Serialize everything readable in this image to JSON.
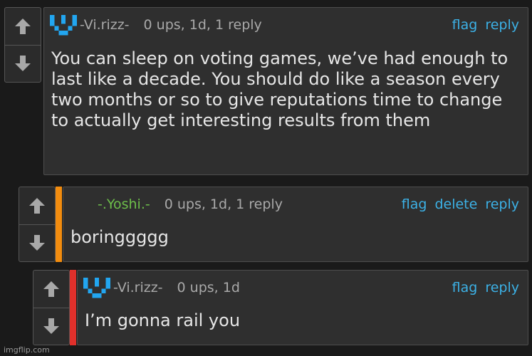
{
  "vote": {
    "up_icon": "arrow-up-icon",
    "down_icon": "arrow-down-icon"
  },
  "comments": [
    {
      "username": "-Vi.rizz-",
      "avatar_icon": "blue-pixel-v-avatar",
      "meta": "0 ups, 1d, 1 reply",
      "actions": {
        "flag": "flag",
        "reply": "reply"
      },
      "text": "You can sleep on voting games, we’ve had enough to last like a decade. You should do like a season every two months or so to give reputations time to change to actually get interesting results from them"
    },
    {
      "username": "-.Yoshi.-",
      "username_color": "#6dbf4a",
      "bar_color": "#f28c0f",
      "meta": "0 ups, 1d, 1 reply",
      "actions": {
        "flag": "flag",
        "delete": "delete",
        "reply": "reply"
      },
      "text": "boringgggg"
    },
    {
      "username": "-Vi.rizz-",
      "avatar_icon": "blue-pixel-v-avatar",
      "bar_color": "#e0302b",
      "meta": "0 ups, 1d",
      "actions": {
        "flag": "flag",
        "reply": "reply"
      },
      "text": "I’m gonna rail you"
    }
  ],
  "watermark": "imgflip.com"
}
